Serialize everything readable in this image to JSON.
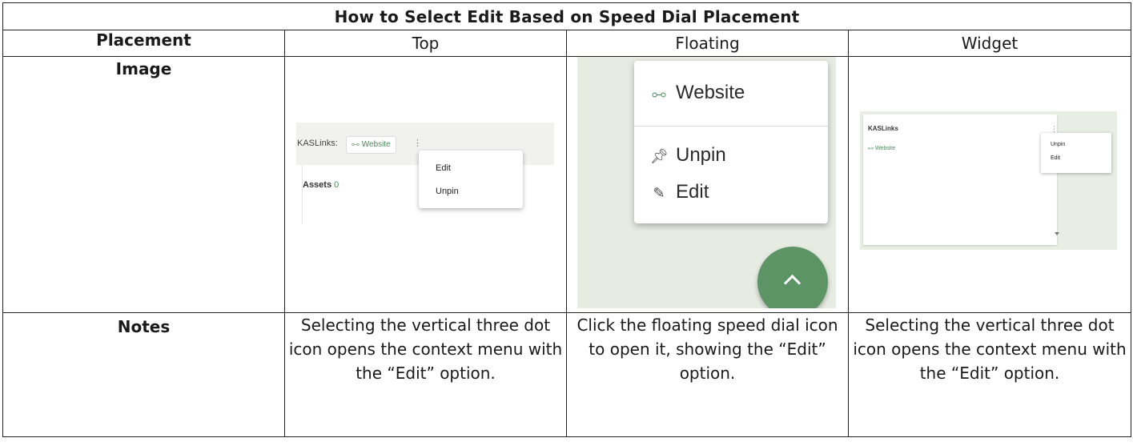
{
  "table": {
    "title": "How to Select Edit Based on Speed Dial Placement",
    "header": {
      "row_label": "Placement",
      "columns": [
        "Top",
        "Floating",
        "Widget"
      ]
    },
    "image_row_label": "Image",
    "notes_row_label": "Notes",
    "notes": [
      "Selecting the vertical three dot icon opens the context menu with the “Edit” option.",
      "Click the floating speed dial icon to open it, showing the “Edit” option.",
      "Selecting the vertical three dot icon opens the context menu with the “Edit” option."
    ]
  },
  "top_image": {
    "kaslinks_label": "KASLinks:",
    "website_chip": "Website",
    "menu_dots": "⋮",
    "assets_label": "Assets",
    "assets_count": "0",
    "menu_items": [
      "Edit",
      "Unpin"
    ]
  },
  "floating_image": {
    "menu_items": [
      {
        "label": "Website",
        "icon": "link-icon"
      },
      {
        "label": "Unpin",
        "icon": "pin-icon"
      },
      {
        "label": "Edit",
        "icon": "pencil-icon"
      }
    ],
    "fab_icon": "chevron-up-icon",
    "fab_color": "#5c9466"
  },
  "widget_image": {
    "title": "KASLinks",
    "website_link": "Website",
    "menu_dots": "⋮",
    "menu_items": [
      "Unpin",
      "Edit"
    ]
  },
  "colors": {
    "accent_green": "#4a8a5a",
    "background_green": "#e6ece2",
    "border": "#222222"
  }
}
